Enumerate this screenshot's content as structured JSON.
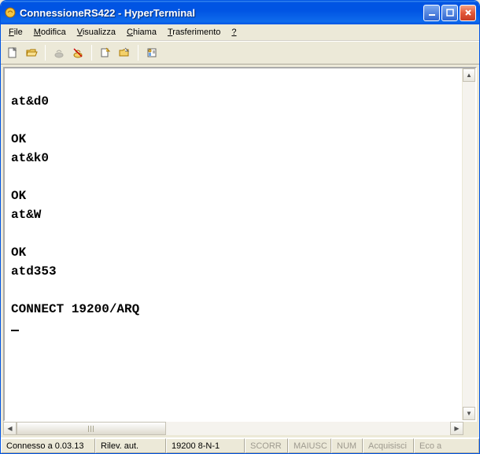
{
  "title": "ConnessioneRS422 - HyperTerminal",
  "menu": {
    "file": "File",
    "modifica": "Modifica",
    "visualizza": "Visualizza",
    "chiama": "Chiama",
    "trasferimento": "Trasferimento",
    "help": "?"
  },
  "terminal": {
    "content": "\nat&d0\n\nOK\nat&k0\n\nOK\nat&W\n\nOK\natd353\n\nCONNECT 19200/ARQ\n"
  },
  "status": {
    "conn": "Connesso a 0.03.13",
    "rilev": "Rilev. aut.",
    "speed": "19200 8-N-1",
    "scorr": "SCORR",
    "maiusc": "MAIUSC",
    "num": "NUM",
    "acq": "Acquisisci",
    "eco": "Eco a"
  }
}
